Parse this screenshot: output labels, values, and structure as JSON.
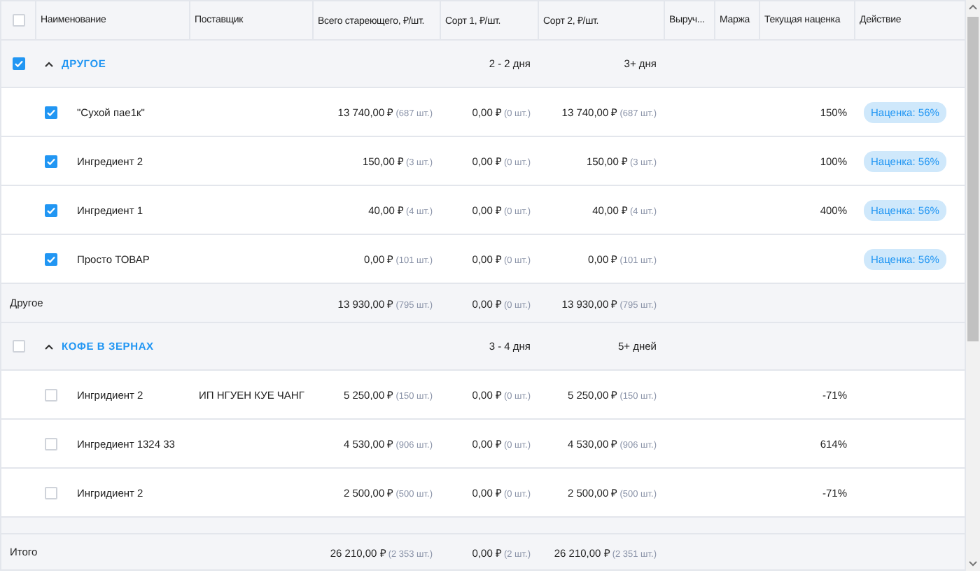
{
  "header": {
    "checked": false,
    "columns": [
      "Наименование",
      "Поставщик",
      "Всего старeющего, ₽/шт.",
      "Сорт 1, ₽/шт.",
      "Сорт 2, ₽/шт.",
      "Выруч...",
      "Маржа",
      "Текущая наценка",
      "Действие"
    ]
  },
  "groups": [
    {
      "name": "ДРУГОЕ",
      "checked": true,
      "expanded": true,
      "sort1_label": "2 - 2 дня",
      "sort2_label": "3+ дня",
      "items": [
        {
          "checked": true,
          "name": "\"Сухой пае1к\"",
          "total": {
            "amount": "13 740,00 ₽",
            "qty": "(687 шт.)"
          },
          "sort1": {
            "amount": "0,00 ₽",
            "qty": "(0 шт.)"
          },
          "sort2": {
            "amount": "13 740,00 ₽",
            "qty": "(687 шт.)"
          },
          "markup": "150%",
          "action": "Наценка: 56%"
        },
        {
          "checked": true,
          "name": "Ингредиент 2",
          "total": {
            "amount": "150,00 ₽",
            "qty": "(3 шт.)"
          },
          "sort1": {
            "amount": "0,00 ₽",
            "qty": "(0 шт.)"
          },
          "sort2": {
            "amount": "150,00 ₽",
            "qty": "(3 шт.)"
          },
          "markup": "100%",
          "action": "Наценка: 56%"
        },
        {
          "checked": true,
          "name": "Ингредиент 1",
          "total": {
            "amount": "40,00 ₽",
            "qty": "(4 шт.)"
          },
          "sort1": {
            "amount": "0,00 ₽",
            "qty": "(0 шт.)"
          },
          "sort2": {
            "amount": "40,00 ₽",
            "qty": "(4 шт.)"
          },
          "markup": "400%",
          "action": "Наценка: 56%"
        },
        {
          "checked": true,
          "name": "Просто ТОВАР",
          "total": {
            "amount": "0,00 ₽",
            "qty": "(101 шт.)"
          },
          "sort1": {
            "amount": "0,00 ₽",
            "qty": "(0 шт.)"
          },
          "sort2": {
            "amount": "0,00 ₽",
            "qty": "(101 шт.)"
          },
          "action": "Наценка: 56%"
        }
      ],
      "subtotal": {
        "label": "Другое",
        "total": {
          "amount": "13 930,00 ₽",
          "qty": "(795 шт.)"
        },
        "sort1": {
          "amount": "0,00 ₽",
          "qty": "(0 шт.)"
        },
        "sort2": {
          "amount": "13 930,00 ₽",
          "qty": "(795 шт.)"
        }
      }
    },
    {
      "name": "КОФЕ В ЗЕРНАХ",
      "checked": false,
      "expanded": true,
      "sort1_label": "3 - 4 дня",
      "sort2_label": "5+ дней",
      "items": [
        {
          "checked": false,
          "name": "Ингридиент 2",
          "supplier": "ИП НГУЕН КУЕ ЧАНГ",
          "total": {
            "amount": "5 250,00 ₽",
            "qty": "(150 шт.)"
          },
          "sort1": {
            "amount": "0,00 ₽",
            "qty": "(0 шт.)"
          },
          "sort2": {
            "amount": "5 250,00 ₽",
            "qty": "(150 шт.)"
          },
          "markup": "-71%"
        },
        {
          "checked": false,
          "name": "Ингредиент 1324 33",
          "total": {
            "amount": "4 530,00 ₽",
            "qty": "(906 шт.)"
          },
          "sort1": {
            "amount": "0,00 ₽",
            "qty": "(0 шт.)"
          },
          "sort2": {
            "amount": "4 530,00 ₽",
            "qty": "(906 шт.)"
          },
          "markup": "614%"
        },
        {
          "checked": false,
          "name": "Ингридиент 2",
          "total": {
            "amount": "2 500,00 ₽",
            "qty": "(500 шт.)"
          },
          "sort1": {
            "amount": "0,00 ₽",
            "qty": "(0 шт.)"
          },
          "sort2": {
            "amount": "2 500,00 ₽",
            "qty": "(500 шт.)"
          },
          "markup": "-71%"
        }
      ]
    }
  ],
  "footer": {
    "label": "Итого",
    "total": {
      "amount": "26 210,00 ₽",
      "qty": "(2 353 шт.)"
    },
    "sort1": {
      "amount": "0,00 ₽",
      "qty": "(2 шт.)"
    },
    "sort2": {
      "amount": "26 210,00 ₽",
      "qty": "(2 351 шт.)"
    }
  }
}
